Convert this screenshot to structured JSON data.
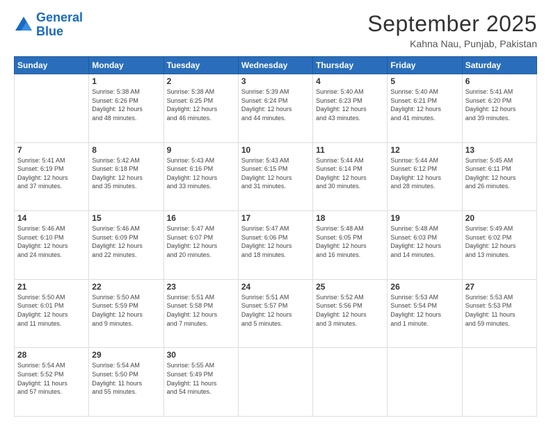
{
  "header": {
    "logo_line1": "General",
    "logo_line2": "Blue",
    "month": "September 2025",
    "location": "Kahna Nau, Punjab, Pakistan"
  },
  "weekdays": [
    "Sunday",
    "Monday",
    "Tuesday",
    "Wednesday",
    "Thursday",
    "Friday",
    "Saturday"
  ],
  "weeks": [
    [
      {
        "day": "",
        "info": ""
      },
      {
        "day": "1",
        "info": "Sunrise: 5:38 AM\nSunset: 6:26 PM\nDaylight: 12 hours\nand 48 minutes."
      },
      {
        "day": "2",
        "info": "Sunrise: 5:38 AM\nSunset: 6:25 PM\nDaylight: 12 hours\nand 46 minutes."
      },
      {
        "day": "3",
        "info": "Sunrise: 5:39 AM\nSunset: 6:24 PM\nDaylight: 12 hours\nand 44 minutes."
      },
      {
        "day": "4",
        "info": "Sunrise: 5:40 AM\nSunset: 6:23 PM\nDaylight: 12 hours\nand 43 minutes."
      },
      {
        "day": "5",
        "info": "Sunrise: 5:40 AM\nSunset: 6:21 PM\nDaylight: 12 hours\nand 41 minutes."
      },
      {
        "day": "6",
        "info": "Sunrise: 5:41 AM\nSunset: 6:20 PM\nDaylight: 12 hours\nand 39 minutes."
      }
    ],
    [
      {
        "day": "7",
        "info": "Sunrise: 5:41 AM\nSunset: 6:19 PM\nDaylight: 12 hours\nand 37 minutes."
      },
      {
        "day": "8",
        "info": "Sunrise: 5:42 AM\nSunset: 6:18 PM\nDaylight: 12 hours\nand 35 minutes."
      },
      {
        "day": "9",
        "info": "Sunrise: 5:43 AM\nSunset: 6:16 PM\nDaylight: 12 hours\nand 33 minutes."
      },
      {
        "day": "10",
        "info": "Sunrise: 5:43 AM\nSunset: 6:15 PM\nDaylight: 12 hours\nand 31 minutes."
      },
      {
        "day": "11",
        "info": "Sunrise: 5:44 AM\nSunset: 6:14 PM\nDaylight: 12 hours\nand 30 minutes."
      },
      {
        "day": "12",
        "info": "Sunrise: 5:44 AM\nSunset: 6:12 PM\nDaylight: 12 hours\nand 28 minutes."
      },
      {
        "day": "13",
        "info": "Sunrise: 5:45 AM\nSunset: 6:11 PM\nDaylight: 12 hours\nand 26 minutes."
      }
    ],
    [
      {
        "day": "14",
        "info": "Sunrise: 5:46 AM\nSunset: 6:10 PM\nDaylight: 12 hours\nand 24 minutes."
      },
      {
        "day": "15",
        "info": "Sunrise: 5:46 AM\nSunset: 6:09 PM\nDaylight: 12 hours\nand 22 minutes."
      },
      {
        "day": "16",
        "info": "Sunrise: 5:47 AM\nSunset: 6:07 PM\nDaylight: 12 hours\nand 20 minutes."
      },
      {
        "day": "17",
        "info": "Sunrise: 5:47 AM\nSunset: 6:06 PM\nDaylight: 12 hours\nand 18 minutes."
      },
      {
        "day": "18",
        "info": "Sunrise: 5:48 AM\nSunset: 6:05 PM\nDaylight: 12 hours\nand 16 minutes."
      },
      {
        "day": "19",
        "info": "Sunrise: 5:48 AM\nSunset: 6:03 PM\nDaylight: 12 hours\nand 14 minutes."
      },
      {
        "day": "20",
        "info": "Sunrise: 5:49 AM\nSunset: 6:02 PM\nDaylight: 12 hours\nand 13 minutes."
      }
    ],
    [
      {
        "day": "21",
        "info": "Sunrise: 5:50 AM\nSunset: 6:01 PM\nDaylight: 12 hours\nand 11 minutes."
      },
      {
        "day": "22",
        "info": "Sunrise: 5:50 AM\nSunset: 5:59 PM\nDaylight: 12 hours\nand 9 minutes."
      },
      {
        "day": "23",
        "info": "Sunrise: 5:51 AM\nSunset: 5:58 PM\nDaylight: 12 hours\nand 7 minutes."
      },
      {
        "day": "24",
        "info": "Sunrise: 5:51 AM\nSunset: 5:57 PM\nDaylight: 12 hours\nand 5 minutes."
      },
      {
        "day": "25",
        "info": "Sunrise: 5:52 AM\nSunset: 5:56 PM\nDaylight: 12 hours\nand 3 minutes."
      },
      {
        "day": "26",
        "info": "Sunrise: 5:53 AM\nSunset: 5:54 PM\nDaylight: 12 hours\nand 1 minute."
      },
      {
        "day": "27",
        "info": "Sunrise: 5:53 AM\nSunset: 5:53 PM\nDaylight: 11 hours\nand 59 minutes."
      }
    ],
    [
      {
        "day": "28",
        "info": "Sunrise: 5:54 AM\nSunset: 5:52 PM\nDaylight: 11 hours\nand 57 minutes."
      },
      {
        "day": "29",
        "info": "Sunrise: 5:54 AM\nSunset: 5:50 PM\nDaylight: 11 hours\nand 55 minutes."
      },
      {
        "day": "30",
        "info": "Sunrise: 5:55 AM\nSunset: 5:49 PM\nDaylight: 11 hours\nand 54 minutes."
      },
      {
        "day": "",
        "info": ""
      },
      {
        "day": "",
        "info": ""
      },
      {
        "day": "",
        "info": ""
      },
      {
        "day": "",
        "info": ""
      }
    ]
  ]
}
